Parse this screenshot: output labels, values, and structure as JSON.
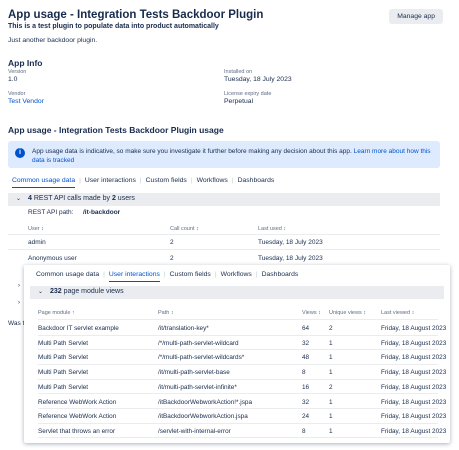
{
  "header": {
    "title": "App usage - Integration Tests Backdoor Plugin",
    "subtitle": "This is a test plugin to populate data into product automatically",
    "description": "Just another backdoor plugin.",
    "manage_label": "Manage app"
  },
  "app_info": {
    "title": "App Info",
    "version_label": "Version",
    "version_value": "1.0",
    "installed_label": "Installed on",
    "installed_value": "Tuesday, 18 July 2023",
    "vendor_label": "Vendor",
    "vendor_value": "Test Vendor",
    "license_label": "License expiry date",
    "license_value": "Perpetual"
  },
  "usage": {
    "title": "App usage - Integration Tests Backdoor Plugin usage",
    "banner_text": "App usage data is indicative, so make sure you investigate it further before making any decision about this app.",
    "banner_link": "Learn more about how this data is tracked"
  },
  "tabs": [
    "Common usage data",
    "User interactions",
    "Custom fields",
    "Workflows",
    "Dashboards"
  ],
  "rest_group": {
    "chevron": "⌄",
    "count": "4",
    "text_mid": "REST API calls made by",
    "users": "2",
    "text_end": "users",
    "path_label": "REST API path:",
    "path_value": "/it-backdoor",
    "columns": [
      "User ↕",
      "Call count ↕",
      "Last used ↕"
    ],
    "rows": [
      [
        "admin",
        "2",
        "Tuesday, 18 July 2023"
      ],
      [
        "Anonymous user",
        "2",
        "Tuesday, 18 July 2023"
      ]
    ]
  },
  "side": {
    "chev1": "›",
    "chev2": "›",
    "partial_text": "Was th"
  },
  "overlay": {
    "group_chevron": "⌄",
    "group_count": "232",
    "group_text": "page module views",
    "columns": [
      "Page module ↑",
      "Path ↕",
      "Views ↕",
      "Unique views ↕",
      "Last viewed ↕"
    ],
    "rows": [
      [
        "Backdoor IT servlet example",
        "/it/translation-key*",
        "64",
        "2",
        "Friday, 18 August 2023"
      ],
      [
        "Multi Path Servlet",
        "/*/multi-path-servlet-wildcard",
        "32",
        "1",
        "Friday, 18 August 2023"
      ],
      [
        "Multi Path Servlet",
        "/*/multi-path-servlet-wildcards*",
        "48",
        "1",
        "Friday, 18 August 2023"
      ],
      [
        "Multi Path Servlet",
        "/it/multi-path-servlet-base",
        "8",
        "1",
        "Friday, 18 August 2023"
      ],
      [
        "Multi Path Servlet",
        "/it/multi-path-servlet-infinite*",
        "16",
        "2",
        "Friday, 18 August 2023"
      ],
      [
        "Reference WebWork Action",
        "/itBackdoorWebworkAction!*.jspa",
        "32",
        "1",
        "Friday, 18 August 2023"
      ],
      [
        "Reference WebWork Action",
        "/itBackdoorWebworkAction.jspa",
        "24",
        "1",
        "Friday, 18 August 2023"
      ],
      [
        "Servlet that throws an error",
        "/servlet-with-internal-error",
        "8",
        "1",
        "Friday, 18 August 2023"
      ]
    ]
  }
}
